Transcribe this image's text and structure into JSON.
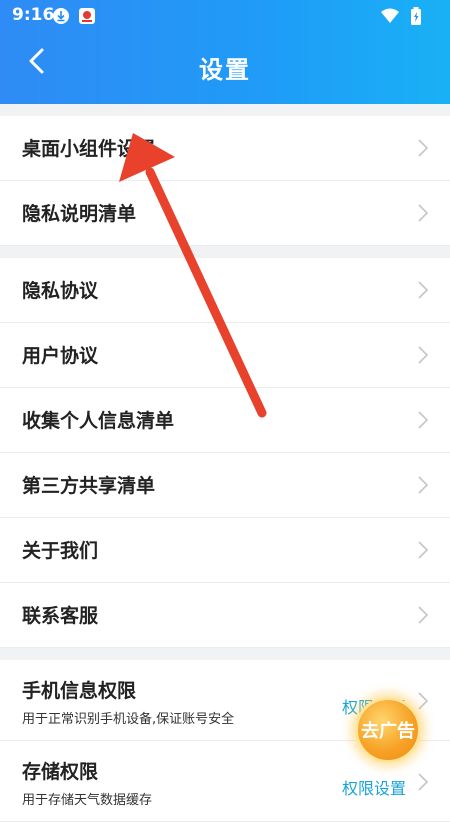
{
  "status_bar": {
    "time": "9:16"
  },
  "header": {
    "title": "设置"
  },
  "group1": [
    {
      "label": "桌面小组件设置"
    },
    {
      "label": "隐私说明清单"
    }
  ],
  "group2": [
    {
      "label": "隐私协议"
    },
    {
      "label": "用户协议"
    },
    {
      "label": "收集个人信息清单"
    },
    {
      "label": "第三方共享清单"
    },
    {
      "label": "关于我们"
    },
    {
      "label": "联系客服"
    }
  ],
  "group3": [
    {
      "label": "手机信息权限",
      "sub": "用于正常识别手机设备,保证账号安全",
      "link": "权限设置"
    },
    {
      "label": "存储权限",
      "sub": "用于存储天气数据缓存",
      "link": "权限设置"
    }
  ],
  "ad_button": {
    "label": "去广告"
  },
  "colors": {
    "header": "#2f8bf5",
    "link": "#1aa4d8",
    "arrow": "#e8412c",
    "ad": "#f7a328"
  }
}
